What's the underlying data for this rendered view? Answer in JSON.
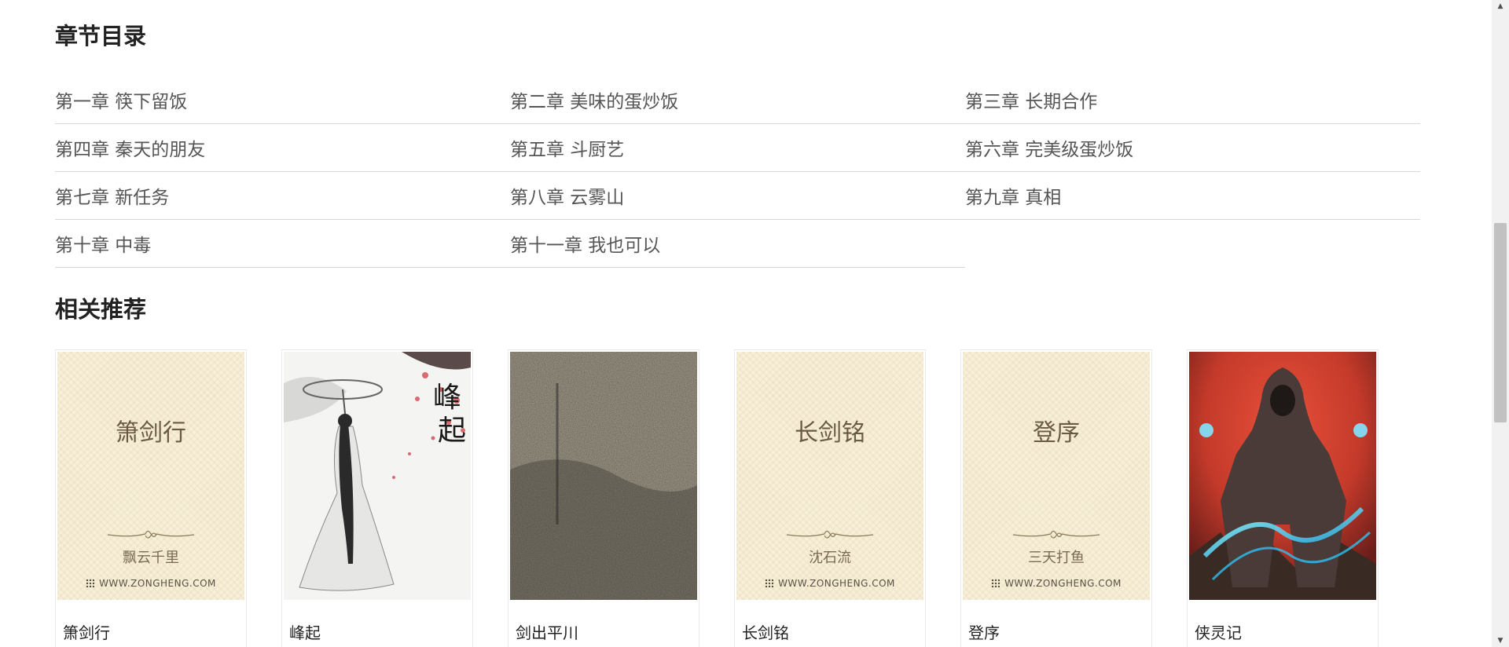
{
  "toc": {
    "title": "章节目录",
    "rows": [
      [
        "第一章 筷下留饭",
        "第二章 美味的蛋炒饭",
        "第三章 长期合作"
      ],
      [
        "第四章 秦天的朋友",
        "第五章 斗厨艺",
        "第六章 完美级蛋炒饭"
      ],
      [
        "第七章 新任务",
        "第八章 云雾山",
        "第九章 真相"
      ],
      [
        "第十章 中毒",
        "第十一章 我也可以"
      ]
    ]
  },
  "recommend": {
    "title": "相关推荐",
    "books": [
      {
        "name": "箫剑行",
        "cover_type": "plain",
        "cover_title": "箫剑行",
        "cover_author": "飘云千里",
        "cover_site": "WWW.ZONGHENG.COM"
      },
      {
        "name": "峰起",
        "cover_type": "ink",
        "cover_title": "峰起"
      },
      {
        "name": "剑出平川",
        "cover_type": "noise"
      },
      {
        "name": "长剑铭",
        "cover_type": "plain",
        "cover_title": "长剑铭",
        "cover_author": "沈石流",
        "cover_site": "WWW.ZONGHENG.COM"
      },
      {
        "name": "登序",
        "cover_type": "plain",
        "cover_title": "登序",
        "cover_author": "三天打鱼",
        "cover_site": "WWW.ZONGHENG.COM"
      },
      {
        "name": "侠灵记",
        "cover_type": "hero"
      }
    ]
  },
  "scrollbar": {
    "up_icon": "triangle-up-icon",
    "down_icon": "triangle-down-icon"
  }
}
